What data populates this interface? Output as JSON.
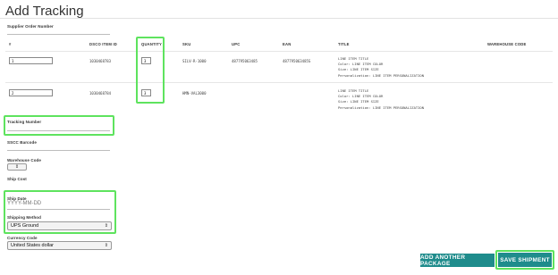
{
  "page": {
    "title": "Add Tracking"
  },
  "supplier": {
    "label": "Supplier Order Number",
    "value": ""
  },
  "table": {
    "headers": {
      "num": "#",
      "item_id": "DSCO ITEM ID",
      "quantity": "QUANTITY",
      "sku": "SKU",
      "upc": "UPC",
      "ean": "EAN",
      "title": "TITLE",
      "warehouse": "WAREHOUSE CODE"
    },
    "rows": [
      {
        "num": "1",
        "item_id": "1030468783",
        "quantity": "3",
        "sku": "SILV-R-1000",
        "upc": "487795063485",
        "ean": "487795063485S",
        "title_lines": [
          "LINE ITEM TITLE",
          "Color: LINE ITEM COLOR",
          "Size: LINE ITEM SIZE",
          "Personalization: LINE ITEM PERSONALIZATION"
        ]
      },
      {
        "num": "2",
        "item_id": "1030468784",
        "quantity": "3",
        "sku": "HMN-VAL3000",
        "upc": "",
        "ean": "",
        "title_lines": [
          "LINE ITEM TITLE",
          "Color: LINE ITEM COLOR",
          "Size: LINE ITEM SIZE",
          "Personalization: LINE ITEM PERSONALIZATION"
        ]
      }
    ]
  },
  "form": {
    "tracking_label": "Tracking Number",
    "tracking_value": "",
    "sscc_label": "SSCC Barcode",
    "warehouse_label": "Warehouse Code",
    "ship_cost_label": "Ship Cost",
    "ship_date_label": "Ship Date",
    "ship_date_placeholder": "YYYY-MM-DD",
    "ship_method_label": "Shipping Method",
    "ship_method_value": "UPS Ground",
    "currency_label": "Currency Code",
    "currency_value": "United States dollar"
  },
  "buttons": {
    "add_package": "ADD ANOTHER PACKAGE",
    "save_shipment": "SAVE SHIPMENT"
  },
  "colors": {
    "highlight": "#5ee35e",
    "button": "#1f8c8c"
  },
  "icons": {
    "select_caret": "chevron-up-down-icon"
  }
}
